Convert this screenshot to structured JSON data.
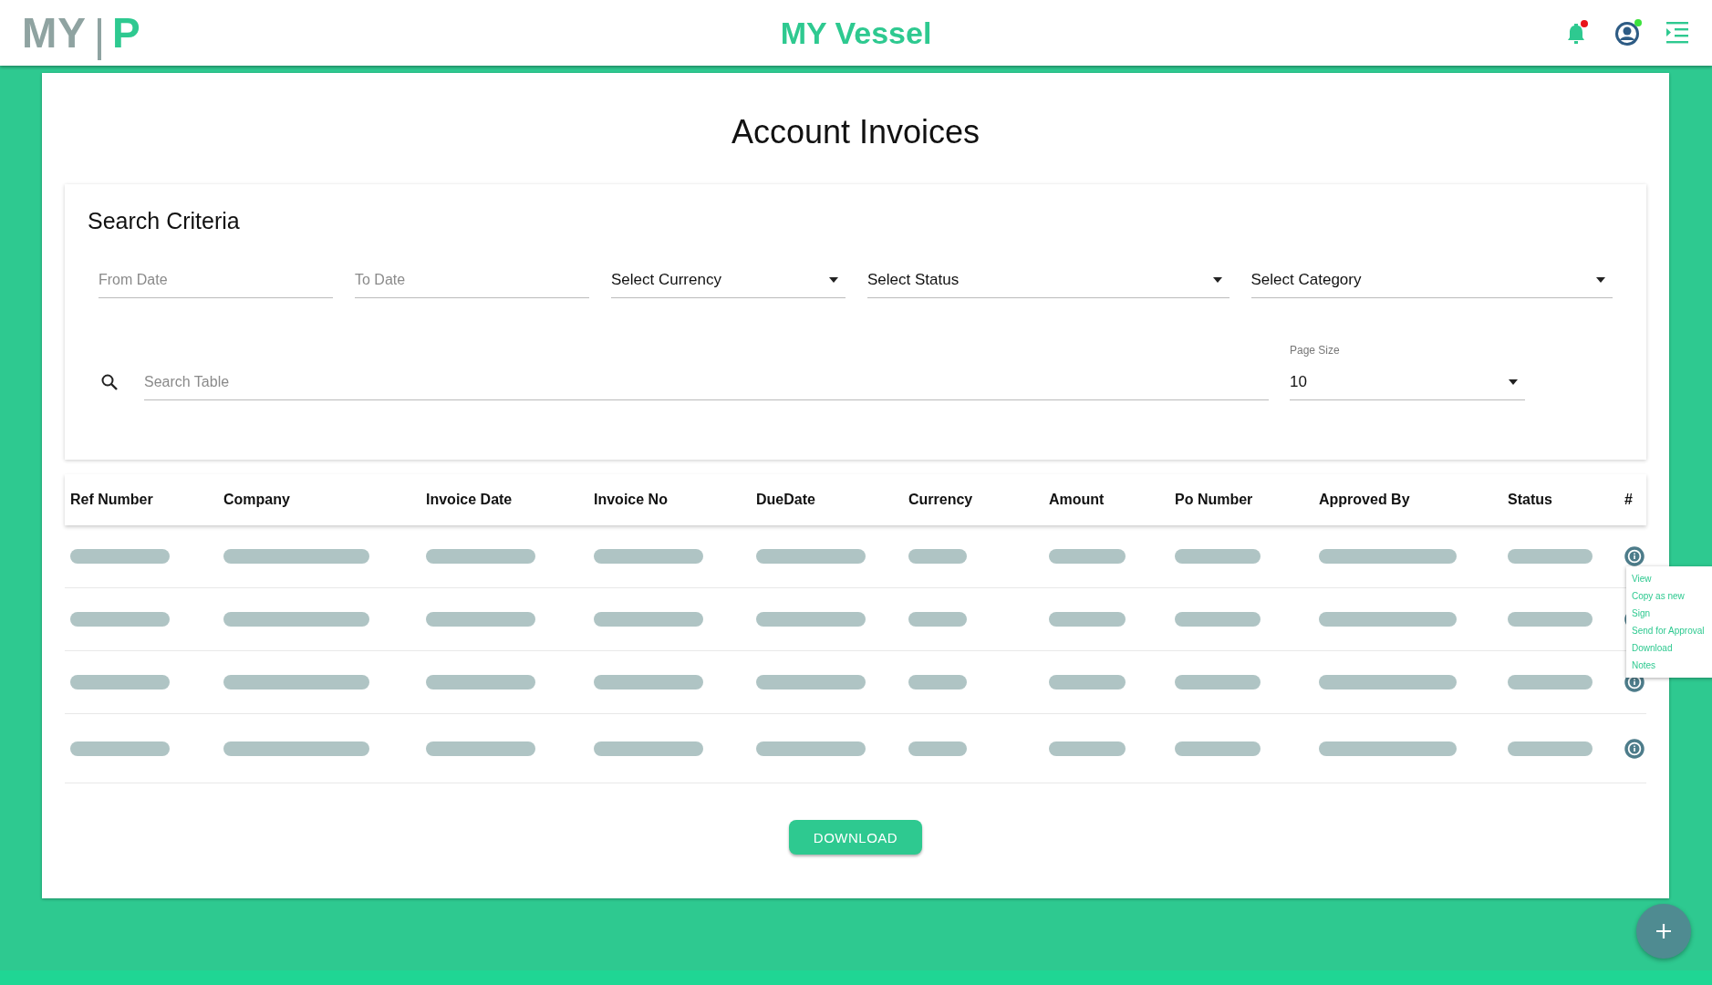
{
  "header": {
    "logo_left": "MY",
    "logo_right": "P",
    "title": "MY Vessel"
  },
  "page_title": "Account Invoices",
  "search": {
    "title": "Search Criteria",
    "filters": [
      {
        "kind": "text",
        "placeholder": "From Date"
      },
      {
        "kind": "text",
        "placeholder": "To Date"
      },
      {
        "kind": "select",
        "value": "Select Currency"
      },
      {
        "kind": "select",
        "value": "Select Status"
      },
      {
        "kind": "select",
        "value": "Select Category"
      }
    ],
    "search_placeholder": "Search Table",
    "page_size_label": "Page Size",
    "page_size": "10"
  },
  "table": {
    "columns": [
      "Ref Number",
      "Company",
      "Invoice Date",
      "Invoice No",
      "DueDate",
      "Currency",
      "Amount",
      "Po Number",
      "Approved By",
      "Status",
      "#"
    ],
    "rows": [
      {
        "menu_open": true
      },
      {
        "menu_open": false
      },
      {
        "menu_open": false
      },
      {
        "menu_open": false
      }
    ]
  },
  "action_menu": [
    "View",
    "Copy as new",
    "Sign",
    "Send for Approval",
    "Download",
    "Notes"
  ],
  "download_button": "DOWNLOAD"
}
